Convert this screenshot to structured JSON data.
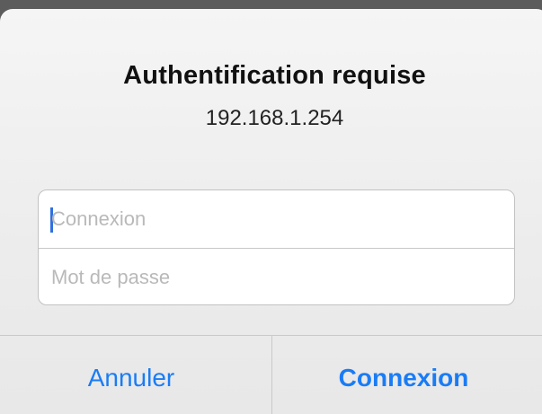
{
  "dialog": {
    "title": "Authentification requise",
    "message": "192.168.1.254"
  },
  "form": {
    "login_placeholder": "Connexion",
    "login_value": "",
    "password_placeholder": "Mot de passe",
    "password_value": ""
  },
  "buttons": {
    "cancel_label": "Annuler",
    "confirm_label": "Connexion"
  },
  "colors": {
    "accent": "#1a7cf5",
    "caret": "#2f6fe0",
    "background_dim": "#5c5c5c"
  }
}
